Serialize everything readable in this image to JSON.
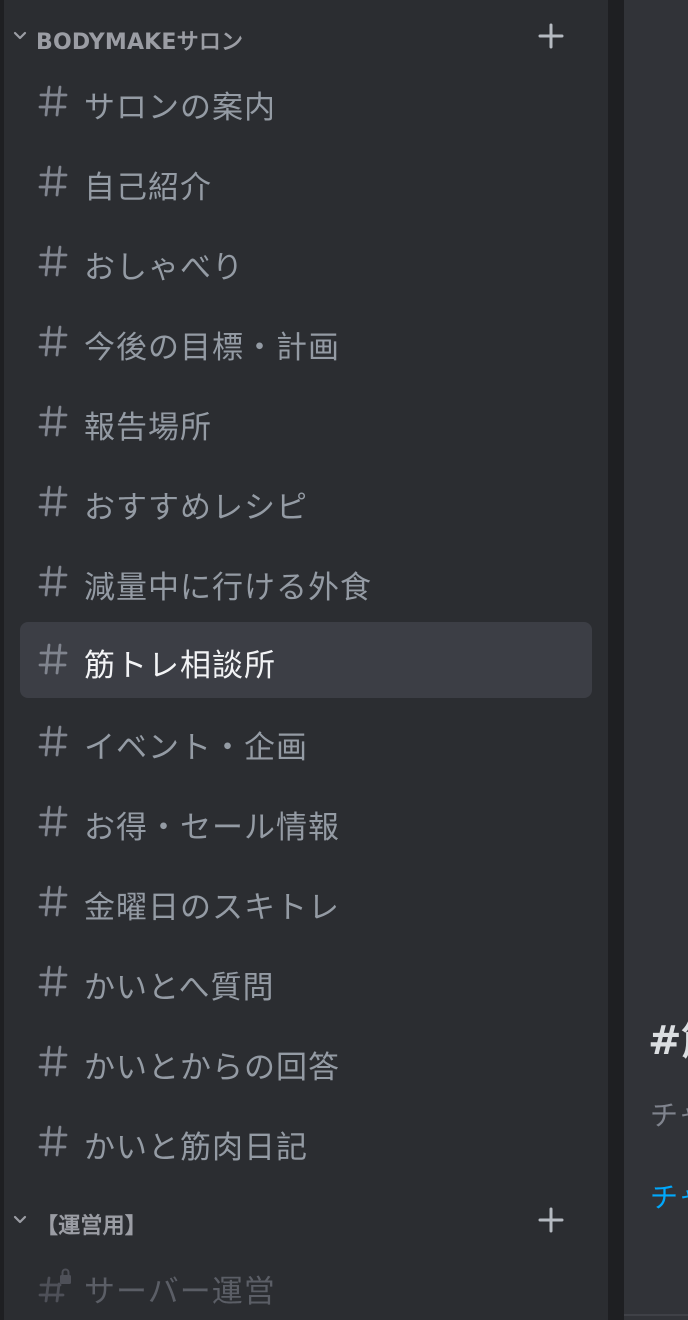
{
  "categories": [
    {
      "label": "BODYMAKEサロン",
      "collapse_icon": "chevron-down-icon",
      "add_icon": "plus-icon"
    },
    {
      "label": "【運営用】",
      "collapse_icon": "chevron-down-icon",
      "add_icon": "plus-icon"
    }
  ],
  "channels": [
    {
      "name": "サロンの案内",
      "icon": "hash-icon"
    },
    {
      "name": "自己紹介",
      "icon": "hash-icon"
    },
    {
      "name": "おしゃべり",
      "icon": "hash-icon"
    },
    {
      "name": "今後の目標・計画",
      "icon": "hash-icon"
    },
    {
      "name": "報告場所",
      "icon": "hash-icon"
    },
    {
      "name": "おすすめレシピ",
      "icon": "hash-icon"
    },
    {
      "name": "減量中に行ける外食",
      "icon": "hash-icon"
    },
    {
      "name": "筋トレ相談所",
      "icon": "hash-icon",
      "selected": true
    },
    {
      "name": "イベント・企画",
      "icon": "hash-icon"
    },
    {
      "name": "お得・セール情報",
      "icon": "hash-icon"
    },
    {
      "name": "金曜日のスキトレ",
      "icon": "hash-icon"
    },
    {
      "name": "かいとへ質問",
      "icon": "hash-icon"
    },
    {
      "name": "かいとからの回答",
      "icon": "hash-icon"
    },
    {
      "name": "かいと筋肉日記",
      "icon": "hash-icon"
    }
  ],
  "admin_channels": [
    {
      "name": "サーバー運営",
      "icon": "locked-hash-icon"
    }
  ],
  "chat_preview": {
    "title_fragment": "#筋",
    "text_fragment": "チャ",
    "link_fragment": "チャ"
  },
  "colors": {
    "sidebar_bg": "#2b2d31",
    "selected_bg": "#3c3e45",
    "channel_text": "#949ba4",
    "selected_text": "#f2f3f5",
    "link": "#00a8fc"
  }
}
